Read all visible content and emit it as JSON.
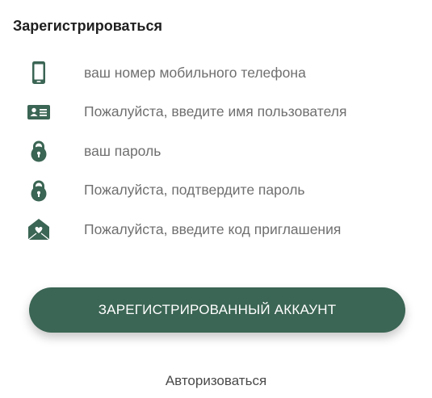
{
  "title": "Зарегистрироваться",
  "fields": [
    {
      "icon": "mobile-phone-icon",
      "placeholder": "ваш номер мобильного телефона"
    },
    {
      "icon": "id-card-icon",
      "placeholder": "Пожалуйста, введите имя пользователя"
    },
    {
      "icon": "lock-icon",
      "placeholder": "ваш пароль"
    },
    {
      "icon": "lock-icon",
      "placeholder": "Пожалуйста, подтвердите пароль"
    },
    {
      "icon": "envelope-heart-icon",
      "placeholder": "Пожалуйста, введите код приглашения"
    }
  ],
  "submit_label": "ЗАРЕГИСТРИРОВАННЫЙ АККАУНТ",
  "login_link": "Авторизоваться",
  "colors": {
    "accent": "#3b6554",
    "icon": "#3b6554"
  }
}
